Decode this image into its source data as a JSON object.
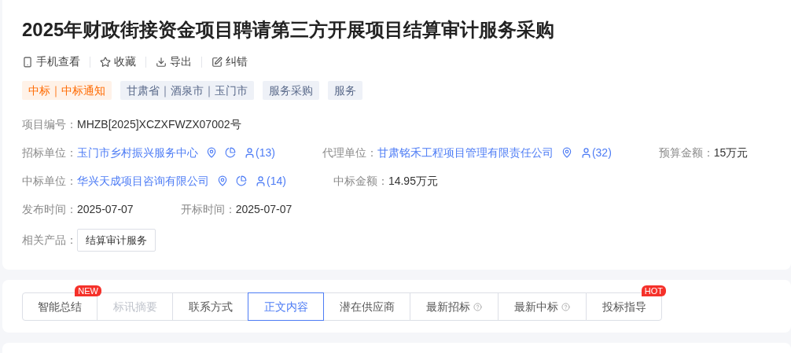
{
  "title": "2025年财政街接资金项目聘请第三方开展项目结算审计服务采购",
  "actions": [
    {
      "kind": "phone",
      "label": "手机查看"
    },
    {
      "kind": "star",
      "label": "收藏"
    },
    {
      "kind": "download",
      "label": "导出"
    },
    {
      "kind": "edit",
      "label": "纠错"
    }
  ],
  "tags": [
    {
      "kind": "status",
      "label": "中标｜中标通知"
    },
    {
      "kind": "plain",
      "label": "甘肃省｜酒泉市｜玉门市"
    },
    {
      "kind": "plain",
      "label": "服务采购"
    },
    {
      "kind": "plain",
      "label": "服务"
    }
  ],
  "info_rows": [
    [
      {
        "label": "项目编号：",
        "kind": "text",
        "value": "MHZB[2025]XCZXFWZX07002号"
      }
    ],
    [
      {
        "label": "招标单位：",
        "kind": "link",
        "value": "玉门市乡村振兴服务中心",
        "icons": [
          {
            "kind": "location"
          },
          {
            "kind": "chart"
          },
          {
            "kind": "contacts",
            "text": "(13)"
          }
        ]
      },
      {
        "label": "代理单位：",
        "kind": "link",
        "value": "甘肃铭禾工程项目管理有限责任公司",
        "icons": [
          {
            "kind": "location"
          },
          {
            "kind": "contacts",
            "text": "(32)"
          }
        ]
      },
      {
        "label": "预算金额：",
        "kind": "text",
        "value": "15万元"
      }
    ],
    [
      {
        "label": "中标单位：",
        "kind": "link",
        "value": "华兴天成项目咨询有限公司",
        "icons": [
          {
            "kind": "location"
          },
          {
            "kind": "chart"
          },
          {
            "kind": "contacts",
            "text": "(14)"
          }
        ]
      },
      {
        "label": "中标金额：",
        "kind": "text",
        "value": "14.95万元"
      }
    ],
    [
      {
        "label": "发布时间：",
        "kind": "text",
        "value": "2025-07-07"
      },
      {
        "label": "开标时间：",
        "kind": "text",
        "value": "2025-07-07"
      }
    ],
    [
      {
        "label": "相关产品：",
        "kind": "product",
        "value": "结算审计服务"
      }
    ]
  ],
  "tabs": [
    {
      "label": "智能总结",
      "selected": false,
      "badge": "NEW"
    },
    {
      "label": "标讯摘要",
      "selected": false,
      "disabled": true
    },
    {
      "label": "联系方式",
      "selected": false
    },
    {
      "label": "正文内容",
      "selected": true
    },
    {
      "label": "潜在供应商",
      "selected": false
    },
    {
      "label": "最新招标",
      "selected": false,
      "help": true
    },
    {
      "label": "最新中标",
      "selected": false,
      "help": true
    },
    {
      "label": "投标指导",
      "selected": false,
      "badge": "HOT"
    }
  ]
}
